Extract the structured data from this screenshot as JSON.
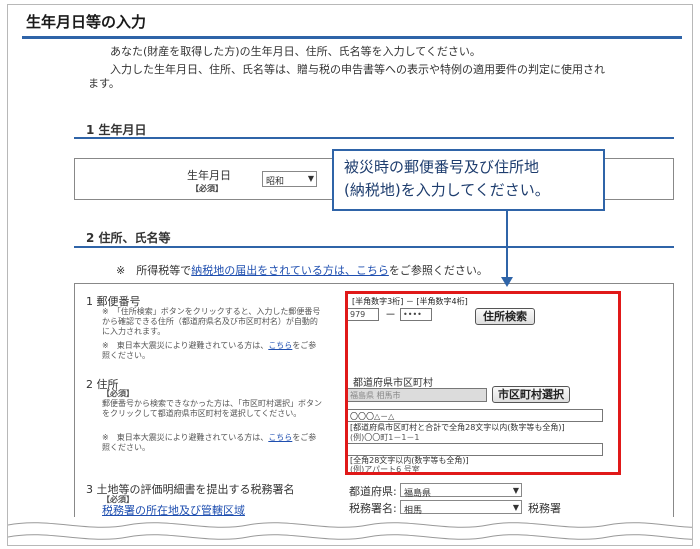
{
  "page": {
    "title": "生年月日等の入力",
    "intro_1": "あなた(財産を取得した方)の生年月日、住所、氏名等を入力してください。",
    "intro_2": "入力した生年月日、住所、氏名等は、贈与税の申告書等への表示や特例の適用要件の判定に使用されます。"
  },
  "section1": {
    "heading": "1 生年月日",
    "birth_label": "生年月日",
    "required_tag": "【必須】",
    "era_select": "昭和"
  },
  "section2": {
    "heading": "2 住所、氏名等",
    "notice_prefix": "※　所得税等で",
    "notice_link": "納税地の届出をされている方は、こちら",
    "notice_suffix": "をご参照ください。"
  },
  "item1": {
    "label": "1 郵便番号",
    "help": "※　「住所検索」ボタンをクリックすると、入力した郵便番号から確認できる住所（都道府県名及び市区町村名）が自動的に入力されます。",
    "note_prefix": "※　東日本大震災により避難されている方は、",
    "note_link": "こちら",
    "note_suffix": "をご参照ください。",
    "hint": "[半角数字3桁] － [半角数字4桁]",
    "postal1": "979",
    "dash": "－",
    "postal2": "••••",
    "search_button": "住所検索"
  },
  "item2": {
    "label": "2 住所",
    "required_tag": "【必須】",
    "help": "郵便番号から検索できなかった方は、「市区町村選択」ボタンをクリックして都道府県市区町村を選択してください。",
    "note_prefix": "※　東日本大震災により避難されている方は、",
    "note_link": "こちら",
    "note_suffix": "をご参照ください。",
    "pref_city_label": "都道府県市区町村",
    "pref_city_value": "福島県 相馬市",
    "city_button": "市区町村選択",
    "address_value": "〇〇〇△－△",
    "address_hint": "[都道府県市区町村と合計で全角28文字以内(数字等も全角)]",
    "address_example": "(例)〇〇町1－1－1",
    "building_hint": "[全角28文字以内(数字等も全角)]",
    "building_example": "(例)アパート6 号室"
  },
  "item3": {
    "label": "3 土地等の評価明細書を提出する税務署名",
    "required_tag": "【必須】",
    "link": "税務署の所在地及び管轄区域",
    "pref_label": "都道府県:",
    "pref_value": "福島県",
    "office_label": "税務署名:",
    "office_value": "相馬",
    "office_suffix": "税務署"
  },
  "callout": {
    "line1": "被災時の郵便番号及び住所地",
    "line2": "(納税地)を入力してください。"
  },
  "colors": {
    "accent": "#2f64a8",
    "highlight": "#e01919"
  }
}
